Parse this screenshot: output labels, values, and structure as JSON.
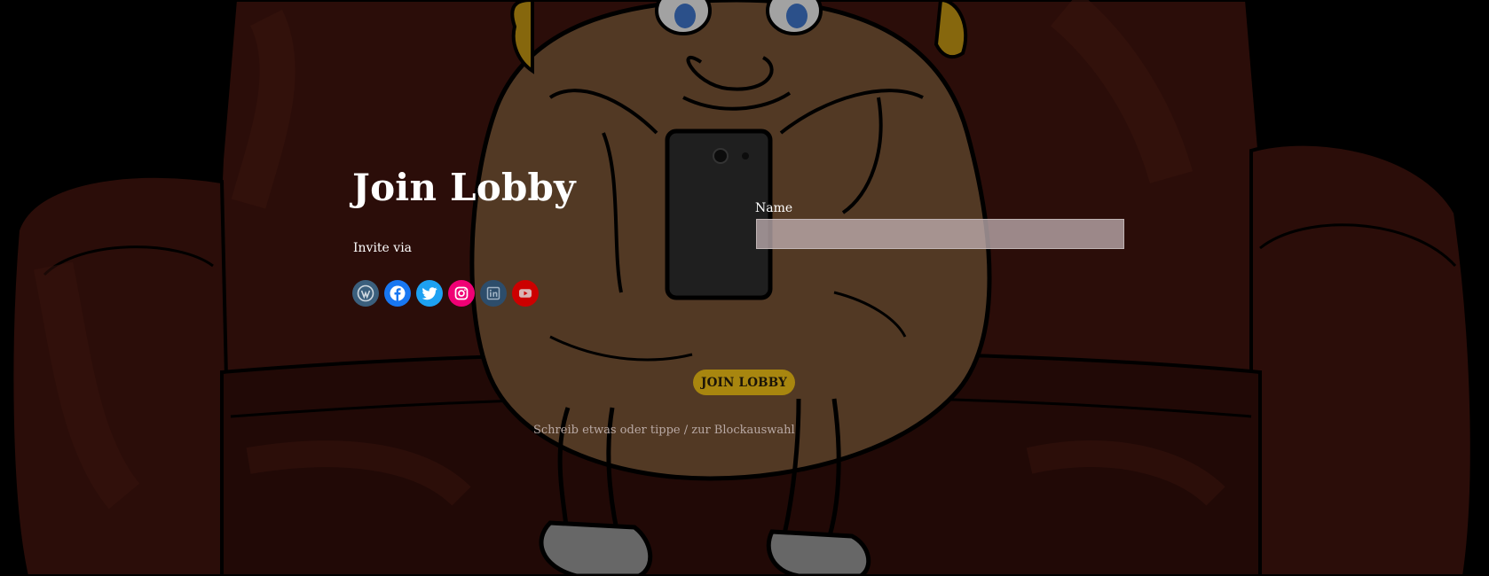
{
  "page": {
    "title": "Join Lobby",
    "invite_label": "Invite via"
  },
  "social": [
    {
      "name": "wordpress-icon",
      "color": "#3b5f7d"
    },
    {
      "name": "facebook-icon",
      "color": "#1877f2"
    },
    {
      "name": "twitter-icon",
      "color": "#1da1f2"
    },
    {
      "name": "instagram-icon",
      "color": "#f00075"
    },
    {
      "name": "linkedin-icon",
      "color": "#2d4d6b"
    },
    {
      "name": "youtube-icon",
      "color": "#cc0000"
    }
  ],
  "form": {
    "name_label": "Name",
    "name_value": "",
    "join_label": "JOIN LOBBY"
  },
  "editor": {
    "hint": "Schreib etwas oder tippe / zur Blockauswahl"
  },
  "colors": {
    "background": "#000000",
    "sofa": "#6b2318",
    "potato": "#8a6343",
    "button": "#a8860f"
  }
}
